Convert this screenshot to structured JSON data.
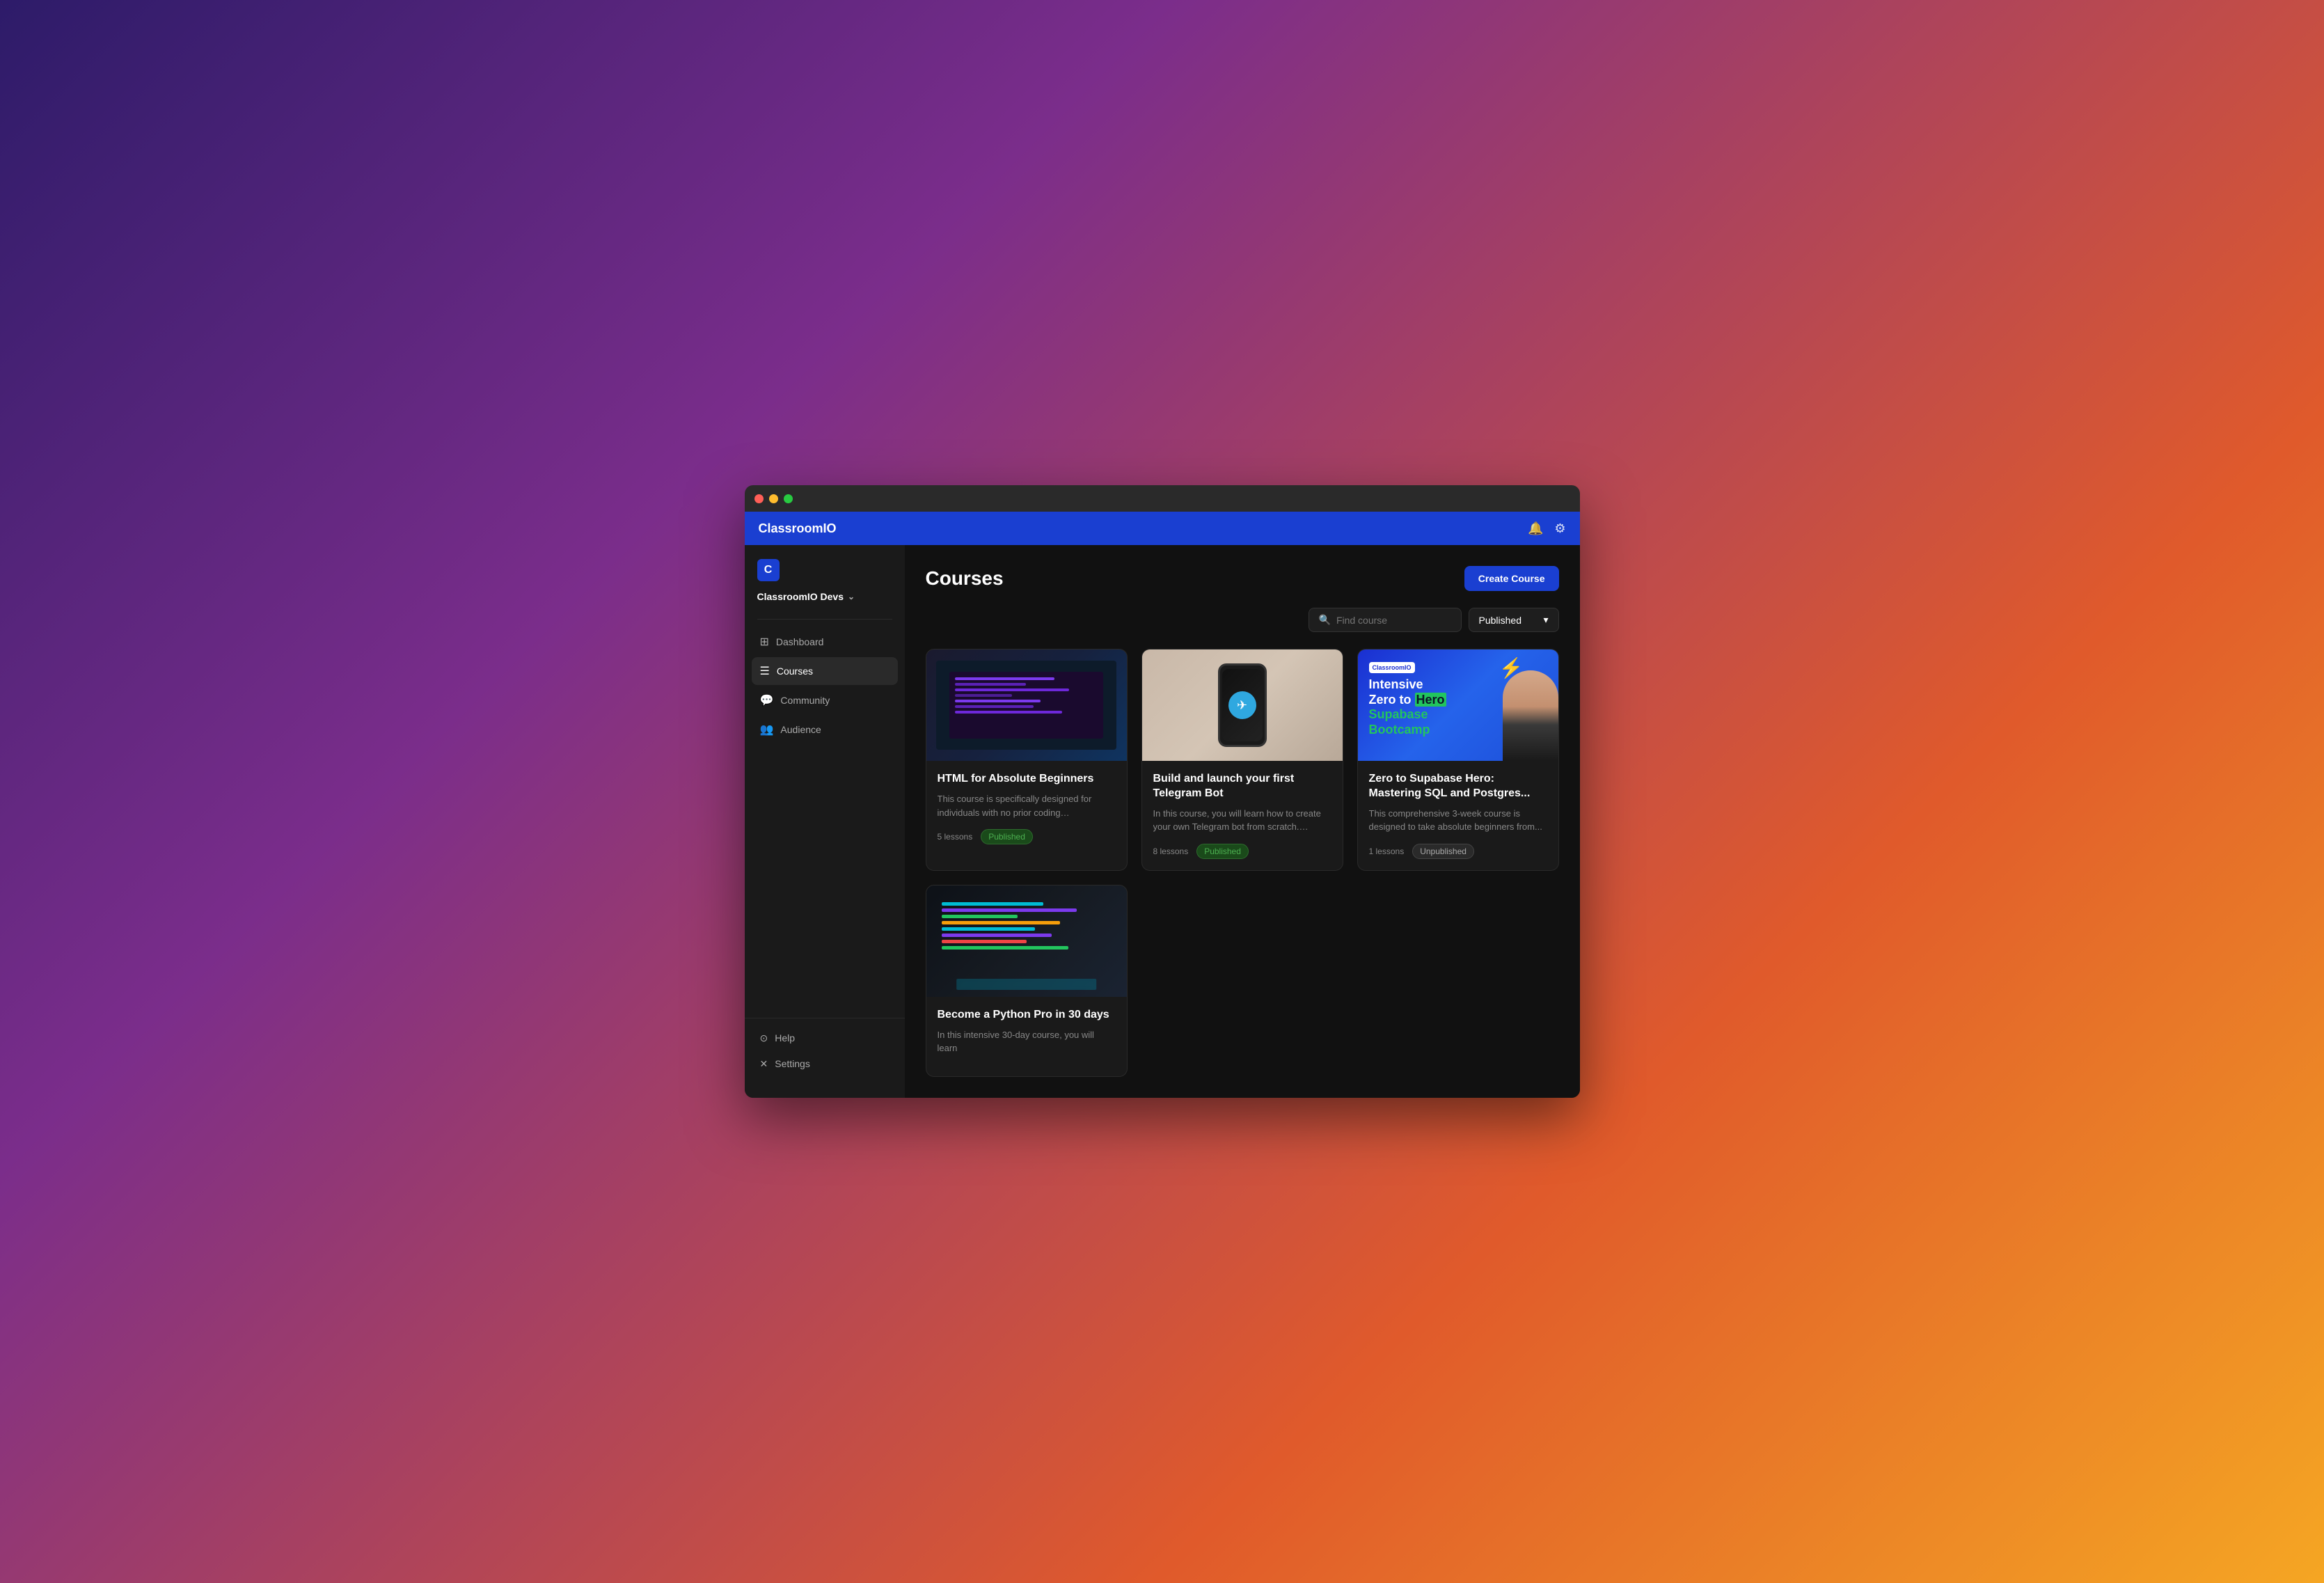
{
  "window": {
    "title": "ClassroomIO"
  },
  "header": {
    "logo": "ClassroomIO",
    "bell_icon": "🔔",
    "settings_icon": "⚙"
  },
  "sidebar": {
    "brand_letter": "C",
    "org_name": "ClassroomIO Devs",
    "nav_items": [
      {
        "id": "dashboard",
        "label": "Dashboard",
        "icon": "⊞"
      },
      {
        "id": "courses",
        "label": "Courses",
        "icon": "☰",
        "active": true
      },
      {
        "id": "community",
        "label": "Community",
        "icon": "💬"
      },
      {
        "id": "audience",
        "label": "Audience",
        "icon": "👥"
      }
    ],
    "bottom_items": [
      {
        "id": "help",
        "label": "Help",
        "icon": "⊙"
      },
      {
        "id": "settings",
        "label": "Settings",
        "icon": "✕"
      }
    ]
  },
  "page": {
    "title": "Courses",
    "create_button": "Create Course",
    "search_placeholder": "Find course",
    "filter_label": "Published",
    "filter_chevron": "▾"
  },
  "courses": [
    {
      "id": "html-beginners",
      "title": "HTML for Absolute Beginners",
      "description": "This course is specifically designed for individuals with no prior coding experience....",
      "lessons": "5 lessons",
      "status": "Published",
      "status_type": "published",
      "thumb_type": "html"
    },
    {
      "id": "telegram-bot",
      "title": "Build and launch your first Telegram Bot",
      "description": "In this course, you will learn how to create your own Telegram bot from scratch. Explor...",
      "lessons": "8 lessons",
      "status": "Published",
      "status_type": "published",
      "thumb_type": "telegram"
    },
    {
      "id": "supabase-hero",
      "title": "Zero to Supabase Hero: Mastering SQL and Postgres...",
      "description": "This comprehensive 3-week course is designed to take absolute beginners from...",
      "lessons": "1 lessons",
      "status": "Unpublished",
      "status_type": "unpublished",
      "thumb_type": "supabase"
    },
    {
      "id": "python-pro",
      "title": "Become a Python Pro in 30 days",
      "description": "In this intensive 30-day course, you will learn",
      "lessons": "",
      "status": "",
      "status_type": "",
      "thumb_type": "python"
    }
  ]
}
